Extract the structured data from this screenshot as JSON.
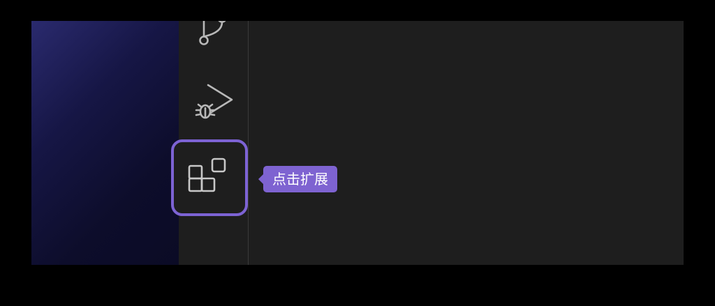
{
  "activity_bar": {
    "items": [
      {
        "icon": "source-control-icon"
      },
      {
        "icon": "run-debug-icon"
      },
      {
        "icon": "extensions-icon",
        "highlighted": true
      }
    ]
  },
  "tooltip": {
    "text": "点击扩展"
  },
  "colors": {
    "highlight": "#7d63d4",
    "tooltip_bg": "#7e63d1",
    "editor_bg": "#1e1e1e"
  }
}
